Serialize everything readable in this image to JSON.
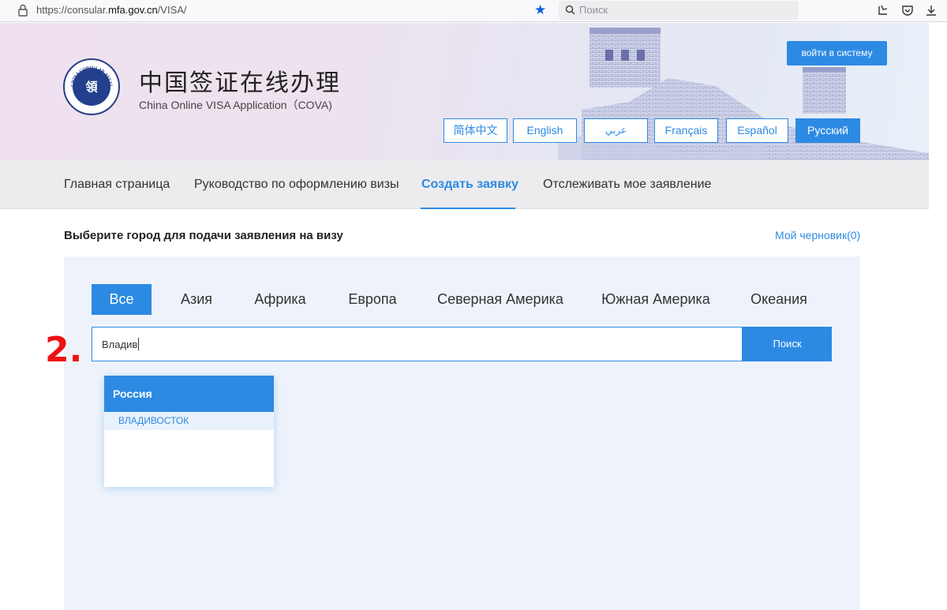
{
  "browser": {
    "url_prefix": "https://consular.",
    "url_domain": "mfa.gov.cn",
    "url_path": "/VISA/",
    "search_placeholder": "Поиск",
    "icons": [
      "lock-icon",
      "bookmark-star-icon",
      "search-icon",
      "library-icon",
      "pocket-icon",
      "download-icon"
    ]
  },
  "header": {
    "title_cn": "中国签证在线办理",
    "title_en": "China Online VISA Application（COVA)",
    "emblem_text": "CHINA CONSULAR AFFAIRS",
    "login_label": "войти в систему",
    "languages": [
      "简体中文",
      "English",
      "عربي",
      "Français",
      "Español",
      "Русский"
    ],
    "active_language": "Русский"
  },
  "nav": {
    "items": [
      "Главная страница",
      "Руководство по оформлению визы",
      "Создать заявку",
      "Отслеживать мое заявление"
    ],
    "active": "Создать заявку"
  },
  "main": {
    "section_title": "Выберите город для подачи заявления на визу",
    "draft_label": "Мой черновик(0)",
    "tabs": [
      "Все",
      "Азия",
      "Африка",
      "Европа",
      "Северная Америка",
      "Южная Америка",
      "Океания"
    ],
    "active_tab": "Все",
    "search_value": "Владив",
    "search_button": "Поиск",
    "step_marker": "2.",
    "dropdown": {
      "country": "Россия",
      "cities": [
        "ВЛАДИВОСТОК"
      ]
    }
  },
  "colors": {
    "accent": "#2d8ae3",
    "marker": "#ee1111"
  }
}
